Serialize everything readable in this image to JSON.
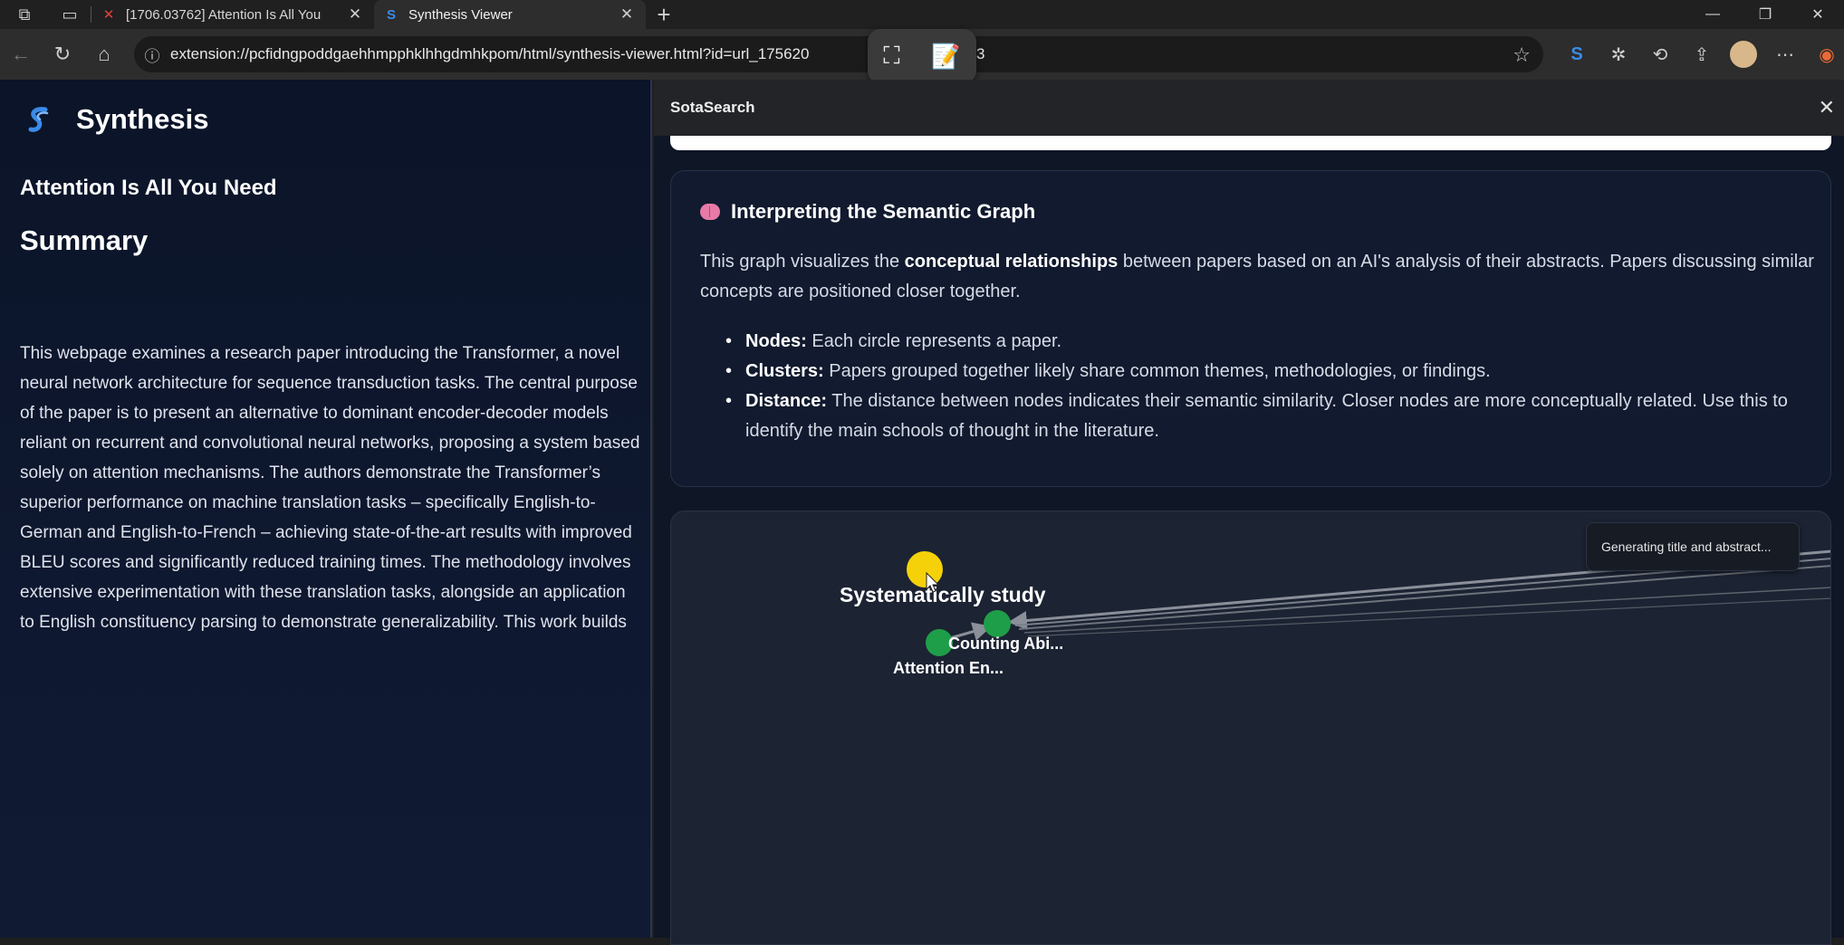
{
  "browser": {
    "tabs": [
      {
        "title": "[1706.03762] Attention Is All You",
        "favicon": "arxiv-x-icon",
        "active": false
      },
      {
        "title": "Synthesis Viewer",
        "favicon": "synthesis-s-icon",
        "active": true
      }
    ],
    "address": "extension://pcfidngpoddgaehhmpphklhhgdmhkpom/html/synthesis-viewer.html?id=url_175620",
    "address_tail": "3"
  },
  "left_panel": {
    "brand": "Synthesis",
    "paper_title": "Attention Is All You Need",
    "summary_heading": "Summary",
    "summary_text": "This webpage examines a research paper introducing the Transformer, a novel neural network architecture for sequence transduction tasks. The central purpose of the paper is to present an alternative to dominant encoder-decoder models reliant on recurrent and convolutional neural networks, proposing a system based solely on attention mechanisms. The authors demonstrate the Transformer’s superior performance on machine translation tasks – specifically English-to-German and English-to-French – achieving state-of-the-art results with improved BLEU scores and significantly reduced training times. The methodology involves extensive experimentation with these translation tasks, alongside an application to English constituency parsing to demonstrate generalizability. This work builds"
  },
  "right_panel": {
    "header": "SotaSearch",
    "info_card": {
      "title": "Interpreting the Semantic Graph",
      "desc_pre": "This graph visualizes the ",
      "desc_bold": "conceptual relationships",
      "desc_post": " between papers based on an AI's analysis of their abstracts. Papers discussing similar concepts are positioned closer together.",
      "items": [
        {
          "label": "Nodes:",
          "text": " Each circle represents a paper."
        },
        {
          "label": "Clusters:",
          "text": " Papers grouped together likely share common themes, methodologies, or findings."
        },
        {
          "label": "Distance:",
          "text": " The distance between nodes indicates their semantic similarity. Closer nodes are more conceptually related. Use this to identify the main schools of thought in the literature."
        }
      ]
    },
    "graph": {
      "tooltip": "Generating title and abstract...",
      "nodes": [
        {
          "label": "Systematically study",
          "color": "#f5d10a"
        },
        {
          "label": "Counting Abi...",
          "color": "#1e9e48"
        },
        {
          "label": "Attention En...",
          "color": "#1e9e48"
        }
      ]
    }
  },
  "colors": {
    "left_bg": "#0b1428",
    "accent_blue": "#3b8be8",
    "node_yellow": "#f5d10a",
    "node_green": "#1e9e48"
  }
}
